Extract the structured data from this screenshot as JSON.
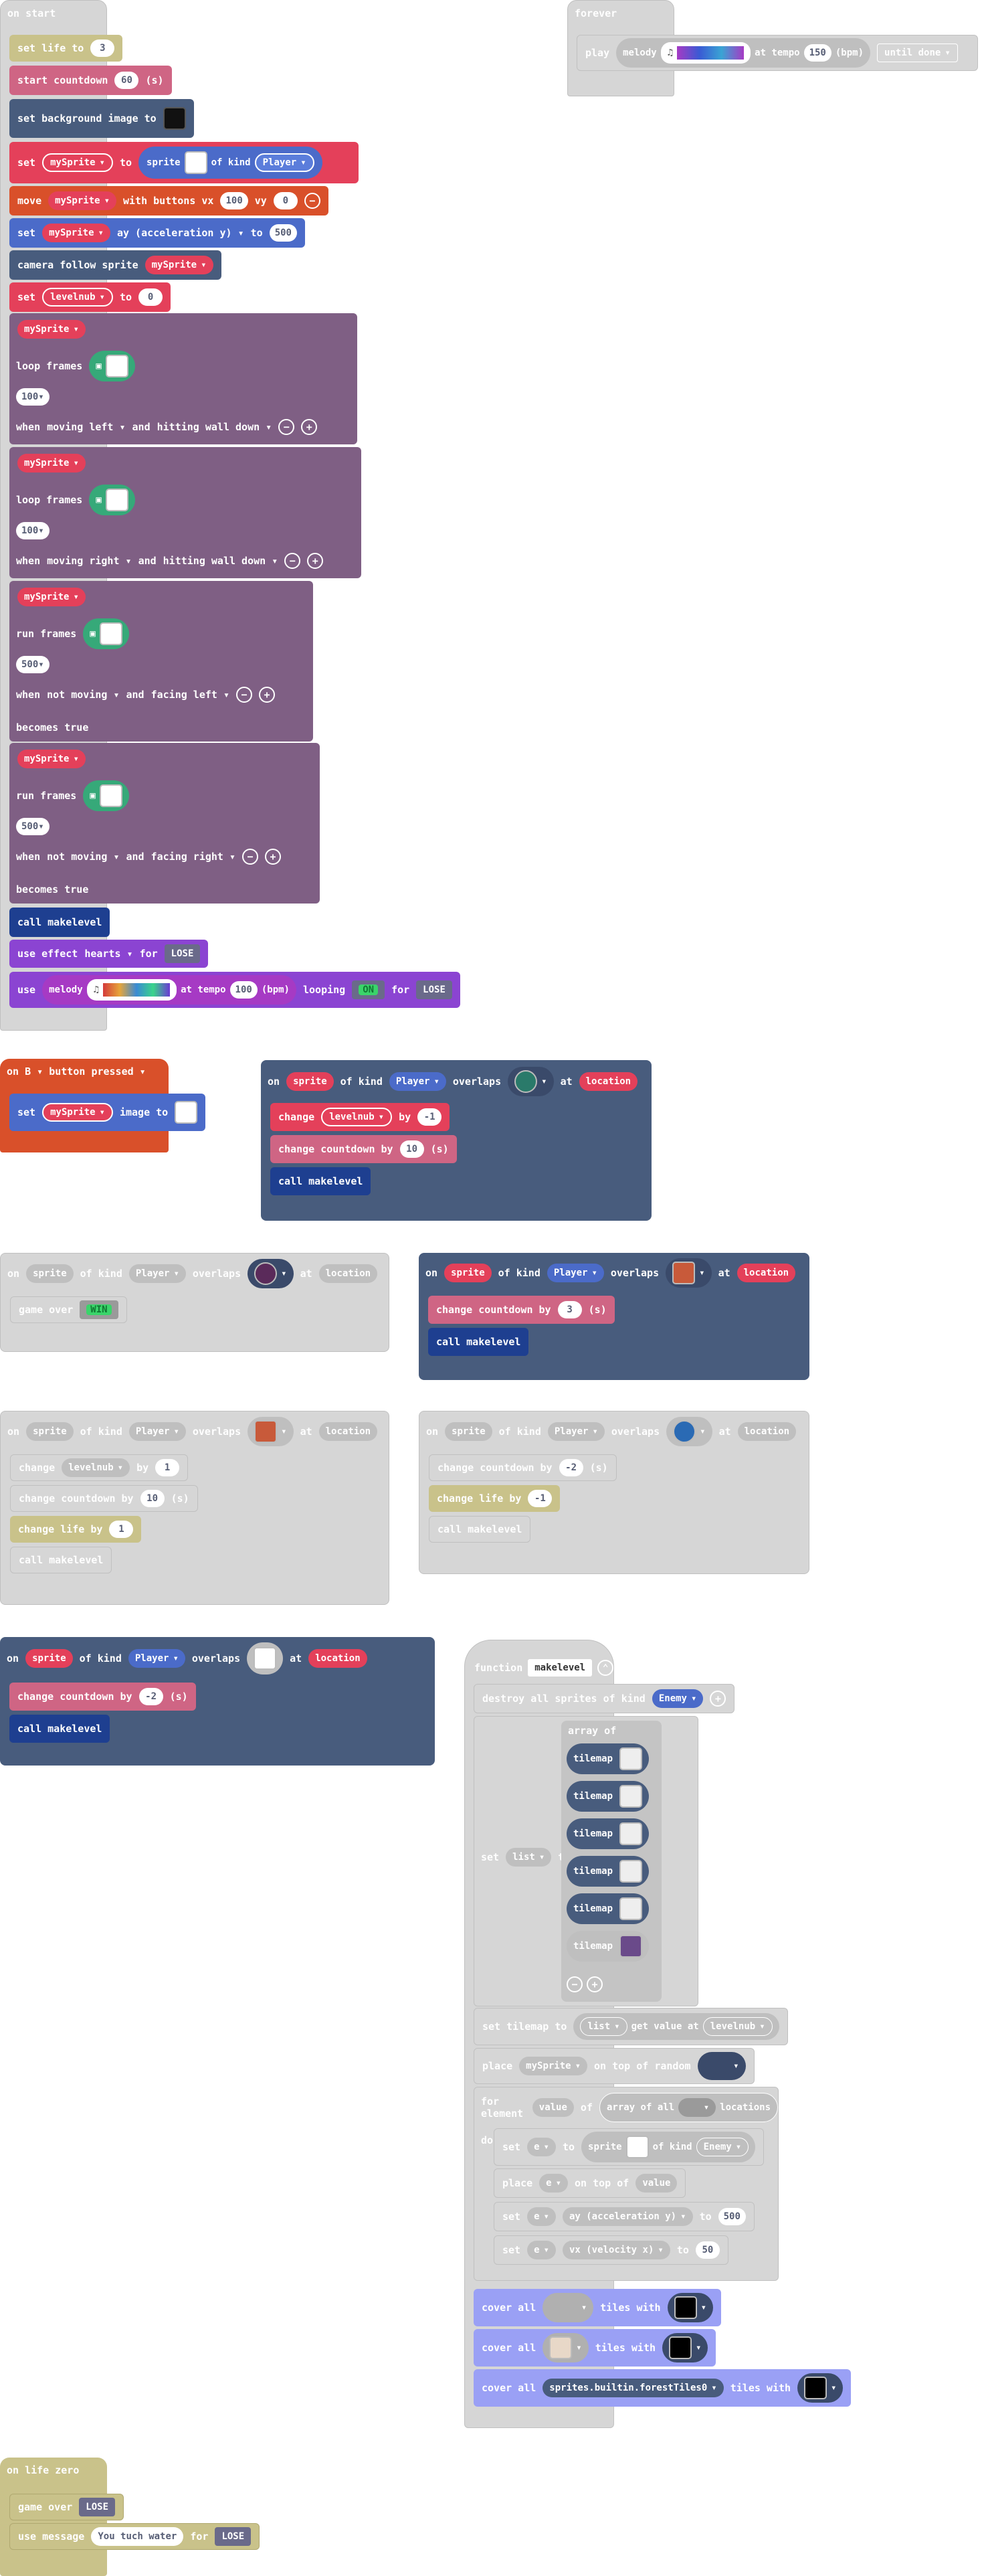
{
  "on_start": {
    "title": "on start",
    "set_life": {
      "text": "set life to",
      "value": "3"
    },
    "start_countdown": {
      "text": "start countdown",
      "value": "60",
      "unit": "(s)"
    },
    "set_bg": {
      "text": "set background image to"
    },
    "set_sprite": {
      "set": "set",
      "var": "mySprite",
      "to": "to",
      "sprite": "sprite",
      "of_kind": "of kind",
      "kind": "Player"
    },
    "move": {
      "text": "move",
      "var": "mySprite",
      "with": "with buttons vx",
      "vx": "100",
      "vy_label": "vy",
      "vy": "0"
    },
    "set_accel": {
      "set": "set",
      "var": "mySprite",
      "prop": "ay (acceleration y)",
      "to": "to",
      "value": "500"
    },
    "camera": {
      "text": "camera follow sprite",
      "var": "mySprite"
    },
    "set_levelnub": {
      "set": "set",
      "var": "levelnub",
      "to": "to",
      "value": "0"
    },
    "anims": [
      {
        "var": "mySprite",
        "frames_label": "loop frames",
        "interval": "100",
        "when": "when",
        "cond1": "moving left",
        "and": "and",
        "cond2": "hitting wall down",
        "becomes": ""
      },
      {
        "var": "mySprite",
        "frames_label": "loop frames",
        "interval": "100",
        "when": "when",
        "cond1": "moving right",
        "and": "and",
        "cond2": "hitting wall down",
        "becomes": ""
      },
      {
        "var": "mySprite",
        "frames_label": "run frames",
        "interval": "500",
        "when": "when",
        "cond1": "not moving",
        "and": "and",
        "cond2": "facing left",
        "becomes": "becomes true"
      },
      {
        "var": "mySprite",
        "frames_label": "run frames",
        "interval": "500",
        "when": "when",
        "cond1": "not moving",
        "and": "and",
        "cond2": "facing right",
        "becomes": "becomes true"
      }
    ],
    "call_makelevel": "call makelevel",
    "use_effect": {
      "use": "use effect",
      "effect": "hearts",
      "for": "for",
      "outcome": "LOSE"
    },
    "use_melody": {
      "use": "use",
      "melody": "melody",
      "at_tempo": "at tempo",
      "tempo": "100",
      "bpm": "(bpm)",
      "looping": "looping",
      "win": "ON",
      "for": "for",
      "lose": "LOSE"
    }
  },
  "forever": {
    "title": "forever",
    "play": "play",
    "melody": "melody",
    "at_tempo": "at tempo",
    "tempo": "150",
    "bpm": "(bpm)",
    "until": "until done"
  },
  "on_button": {
    "on": "on",
    "button": "B",
    "label": "button",
    "event": "pressed",
    "set": "set",
    "var": "mySprite",
    "image_to": "image to"
  },
  "overlap_blocks": [
    {
      "on": "on",
      "sprite": "sprite",
      "of_kind": "of kind",
      "kind": "Player",
      "overlaps": "overlaps",
      "at": "at",
      "location": "location",
      "lines": [
        {
          "a": "change",
          "var": "levelnub",
          "b": "by",
          "value": "-1",
          "unit": ""
        },
        {
          "a": "change countdown by",
          "var": "",
          "b": "",
          "value": "10",
          "unit": "(s)"
        },
        {
          "a": "call makelevel",
          "var": "",
          "b": "",
          "value": "",
          "unit": ""
        }
      ]
    },
    {
      "on": "on",
      "sprite": "sprite",
      "of_kind": "of kind",
      "kind": "Player",
      "overlaps": "overlaps",
      "at": "at",
      "location": "location",
      "lines": [
        {
          "a": "game over",
          "var": "",
          "b": "",
          "value": "WIN",
          "unit": ""
        }
      ]
    },
    {
      "on": "on",
      "sprite": "sprite",
      "of_kind": "of kind",
      "kind": "Player",
      "overlaps": "overlaps",
      "at": "at",
      "location": "location",
      "lines": [
        {
          "a": "change countdown by",
          "var": "",
          "b": "",
          "value": "3",
          "unit": "(s)"
        },
        {
          "a": "call makelevel",
          "var": "",
          "b": "",
          "value": "",
          "unit": ""
        }
      ]
    },
    {
      "on": "on",
      "sprite": "sprite",
      "of_kind": "of kind",
      "kind": "Player",
      "overlaps": "overlaps",
      "at": "at",
      "location": "location",
      "lines": [
        {
          "a": "change",
          "var": "levelnub",
          "b": "by",
          "value": "1",
          "unit": ""
        },
        {
          "a": "change countdown by",
          "var": "",
          "b": "",
          "value": "10",
          "unit": "(s)"
        },
        {
          "a": "change life by",
          "var": "",
          "b": "",
          "value": "1",
          "unit": ""
        },
        {
          "a": "call makelevel",
          "var": "",
          "b": "",
          "value": "",
          "unit": ""
        }
      ]
    },
    {
      "on": "on",
      "sprite": "sprite",
      "of_kind": "of kind",
      "kind": "Player",
      "overlaps": "overlaps",
      "at": "at",
      "location": "location",
      "lines": [
        {
          "a": "change countdown by",
          "var": "",
          "b": "",
          "value": "-2",
          "unit": "(s)"
        },
        {
          "a": "change life by",
          "var": "",
          "b": "",
          "value": "-1",
          "unit": ""
        },
        {
          "a": "call makelevel",
          "var": "",
          "b": "",
          "value": "",
          "unit": ""
        }
      ]
    },
    {
      "on": "on",
      "sprite": "sprite",
      "of_kind": "of kind",
      "kind": "Player",
      "overlaps": "overlaps",
      "at": "at",
      "location": "location",
      "lines": [
        {
          "a": "change countdown by",
          "var": "",
          "b": "",
          "value": "-2",
          "unit": "(s)"
        },
        {
          "a": "call makelevel",
          "var": "",
          "b": "",
          "value": "",
          "unit": ""
        }
      ]
    }
  ],
  "function": {
    "label": "function",
    "name": "makelevel",
    "destroy": {
      "text": "destroy all sprites of kind",
      "kind": "Enemy"
    },
    "set_list": {
      "set": "set",
      "var": "list",
      "to": "to",
      "array_of": "array of",
      "item": "tilemap"
    },
    "set_tilemap": {
      "text": "set tilemap to",
      "var": "list",
      "get": "get value at",
      "index": "levelnub"
    },
    "place": {
      "text": "place",
      "var": "mySprite",
      "on": "on top of random"
    },
    "for_element": {
      "text": "for element",
      "var": "value",
      "of": "of",
      "array": "array of all",
      "locations": "locations"
    },
    "do": "do",
    "do_set": {
      "set": "set",
      "var": "e",
      "to": "to",
      "sprite": "sprite",
      "of_kind": "of kind",
      "kind": "Enemy"
    },
    "do_place": {
      "text": "place",
      "var": "e",
      "on": "on top of",
      "loc": "value"
    },
    "do_set_ay": {
      "set": "set",
      "var": "e",
      "prop": "ay (acceleration y)",
      "to": "to",
      "value": "500"
    },
    "do_set_vx": {
      "set": "set",
      "var": "e",
      "prop": "vx (velocity x)",
      "to": "to",
      "value": "50"
    },
    "cover1": {
      "text": "cover all",
      "with": "tiles with"
    },
    "cover2": {
      "text": "cover all",
      "with": "tiles with"
    },
    "cover3": {
      "text": "cover all",
      "tile": "sprites.builtin.forestTiles0",
      "with": "tiles with"
    }
  },
  "on_life_zero": {
    "title": "on life zero",
    "game_over": "game over",
    "lose": "LOSE",
    "use_message": "use message",
    "message": "You tuch water",
    "for": "for",
    "outcome": "LOSE"
  }
}
